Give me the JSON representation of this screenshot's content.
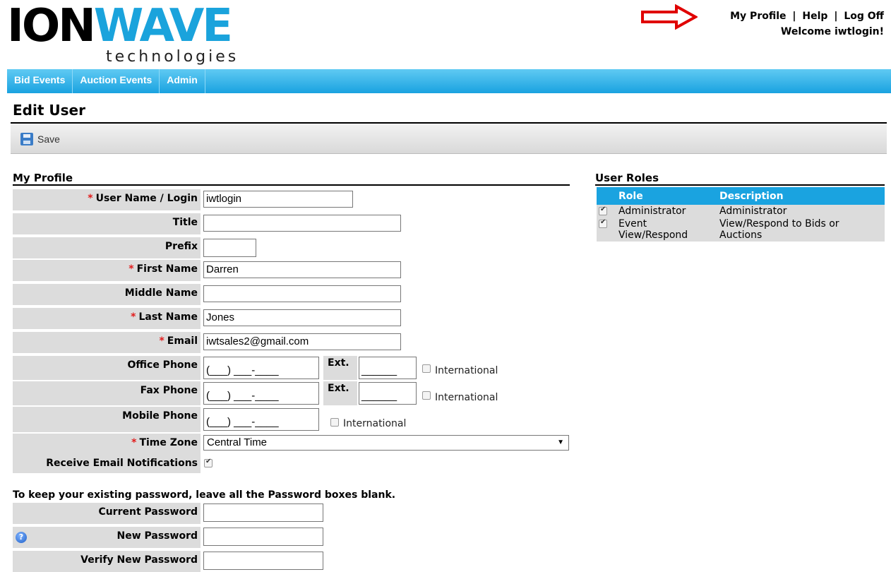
{
  "brand": {
    "logo_part1": "ION",
    "logo_part2": "WAVE",
    "logo_sub": "technologies"
  },
  "top_links": {
    "my_profile": "My Profile",
    "help": "Help",
    "log_off": "Log Off",
    "separator": "|",
    "welcome": "Welcome iwtlogin!"
  },
  "nav": {
    "tabs": [
      "Bid Events",
      "Auction Events",
      "Admin"
    ]
  },
  "page": {
    "title": "Edit User"
  },
  "toolbar": {
    "save_label": "Save"
  },
  "profile": {
    "heading": "My Profile",
    "required_mark": "*",
    "labels": {
      "username": "User Name / Login",
      "title": "Title",
      "prefix": "Prefix",
      "first_name": "First Name",
      "middle_name": "Middle Name",
      "last_name": "Last Name",
      "email": "Email",
      "office_phone": "Office Phone",
      "fax_phone": "Fax Phone",
      "mobile_phone": "Mobile Phone",
      "time_zone": "Time Zone",
      "notifications": "Receive Email Notifications",
      "ext": "Ext.",
      "international": "International"
    },
    "values": {
      "username": "iwtlogin",
      "title": "",
      "prefix": "",
      "first_name": "Darren",
      "middle_name": "",
      "last_name": "Jones",
      "email": "iwtsales2@gmail.com",
      "phone_mask": "(___) ___-____",
      "ext_mask": "______",
      "time_zone": "Central Time",
      "notifications_checked": true,
      "international_checked": false
    }
  },
  "password": {
    "note": "To keep your existing password, leave all the Password boxes blank.",
    "labels": {
      "current": "Current Password",
      "new": "New Password",
      "verify": "Verify New Password"
    }
  },
  "roles": {
    "heading": "User Roles",
    "columns": [
      "Role",
      "Description"
    ],
    "rows": [
      {
        "role": "Administrator",
        "description": "Administrator",
        "checked": true
      },
      {
        "role": "Event View/Respond",
        "description": "View/Respond to Bids or Auctions",
        "checked": true
      }
    ]
  },
  "colors": {
    "accent": "#1aa3e0",
    "required": "#e21b1b",
    "annotation_arrow": "#e00000"
  }
}
